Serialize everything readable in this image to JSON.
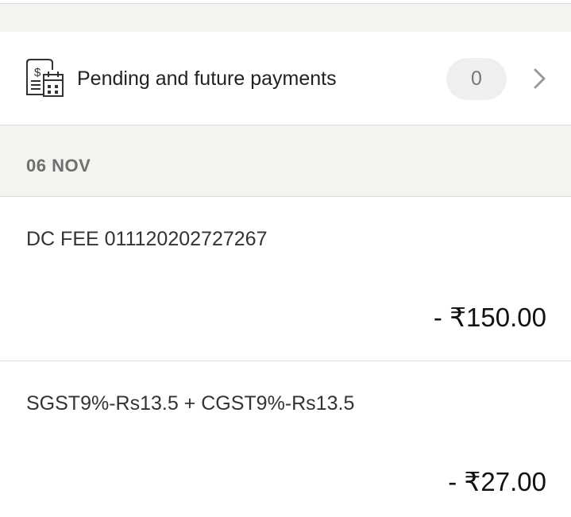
{
  "pending": {
    "icon": "bill-calendar-icon",
    "label": "Pending and future payments",
    "count": "0",
    "chevron_icon": "chevron-right-icon"
  },
  "date_header": "06 NOV",
  "transactions": [
    {
      "description": "DC FEE 011120202727267",
      "amount": "- ₹150.00"
    },
    {
      "description": "SGST9%-Rs13.5 + CGST9%-Rs13.5",
      "amount": "- ₹27.00"
    }
  ],
  "colors": {
    "band_background": "#f4f3f0",
    "badge_background": "#efefed",
    "divider": "#dcdcdc",
    "muted_text": "#6f6f6f"
  }
}
